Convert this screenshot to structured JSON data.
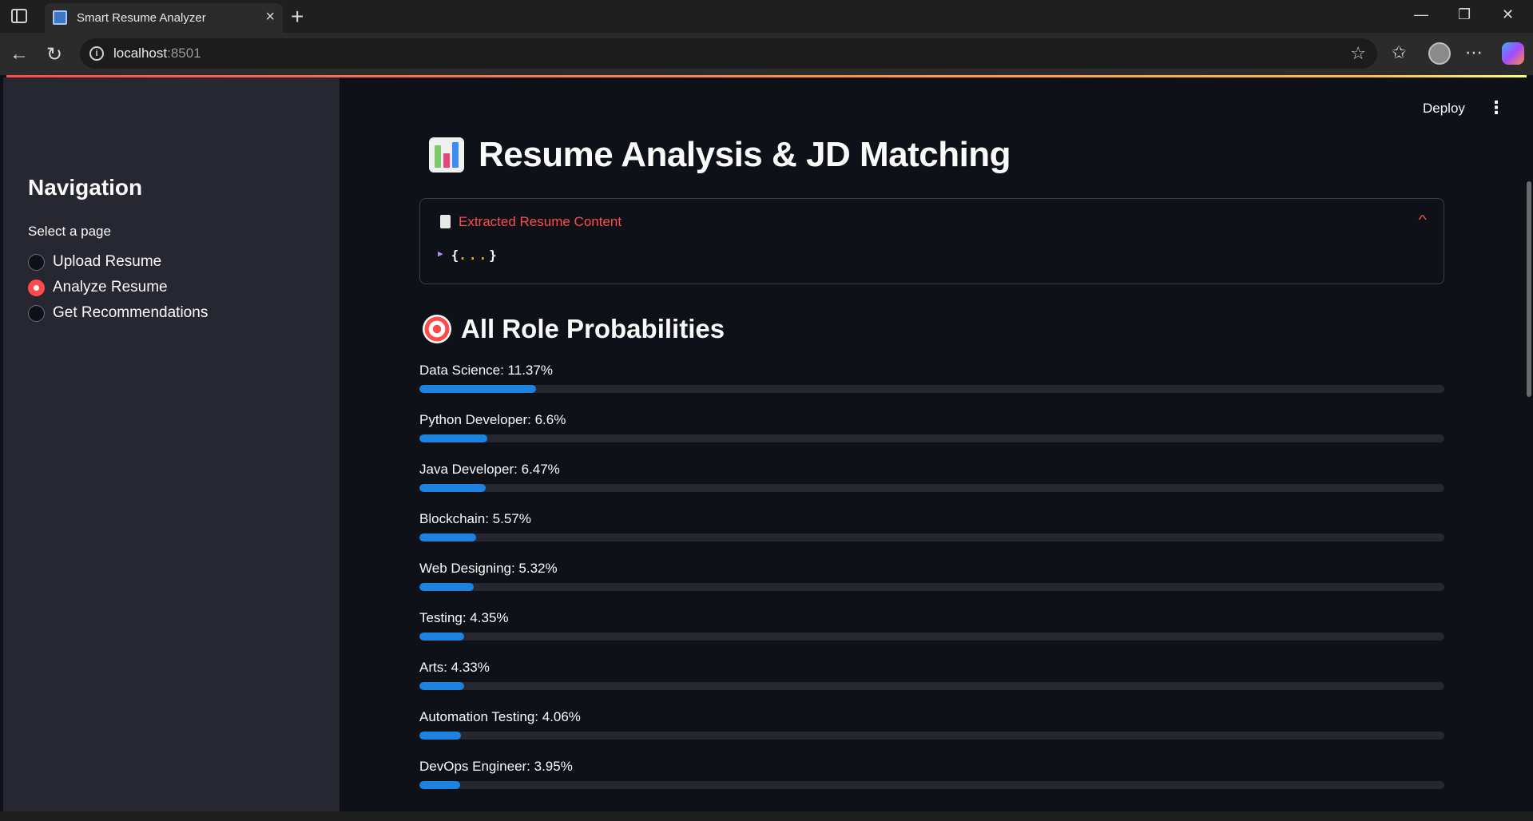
{
  "browser": {
    "tab_title": "Smart Resume Analyzer",
    "url_host": "localhost",
    "url_port": ":8501"
  },
  "sidebar": {
    "title": "Navigation",
    "radio_label": "Select a page",
    "options": [
      {
        "label": "Upload Resume",
        "selected": false
      },
      {
        "label": "Analyze Resume",
        "selected": true
      },
      {
        "label": "Get Recommendations",
        "selected": false
      }
    ]
  },
  "header": {
    "deploy_label": "Deploy"
  },
  "main": {
    "title": "Resume Analysis & JD Matching",
    "expander": {
      "label": "Extracted Resume Content",
      "json_preview_open": "{",
      "json_preview_dots": "...",
      "json_preview_close": "}"
    },
    "section_title": "All Role Probabilities",
    "probabilities": [
      {
        "label": "Data Science: 11.37%",
        "value": 11.37
      },
      {
        "label": "Python Developer: 6.6%",
        "value": 6.6
      },
      {
        "label": "Java Developer: 6.47%",
        "value": 6.47
      },
      {
        "label": "Blockchain: 5.57%",
        "value": 5.57
      },
      {
        "label": "Web Designing: 5.32%",
        "value": 5.32
      },
      {
        "label": "Testing: 4.35%",
        "value": 4.35
      },
      {
        "label": "Arts: 4.33%",
        "value": 4.33
      },
      {
        "label": "Automation Testing: 4.06%",
        "value": 4.06
      },
      {
        "label": "DevOps Engineer: 3.95%",
        "value": 3.95
      }
    ]
  },
  "colors": {
    "accent": "#ff4b4b",
    "progress": "#1c83e1",
    "sidebar_bg": "#262730",
    "main_bg": "#0e1117"
  }
}
